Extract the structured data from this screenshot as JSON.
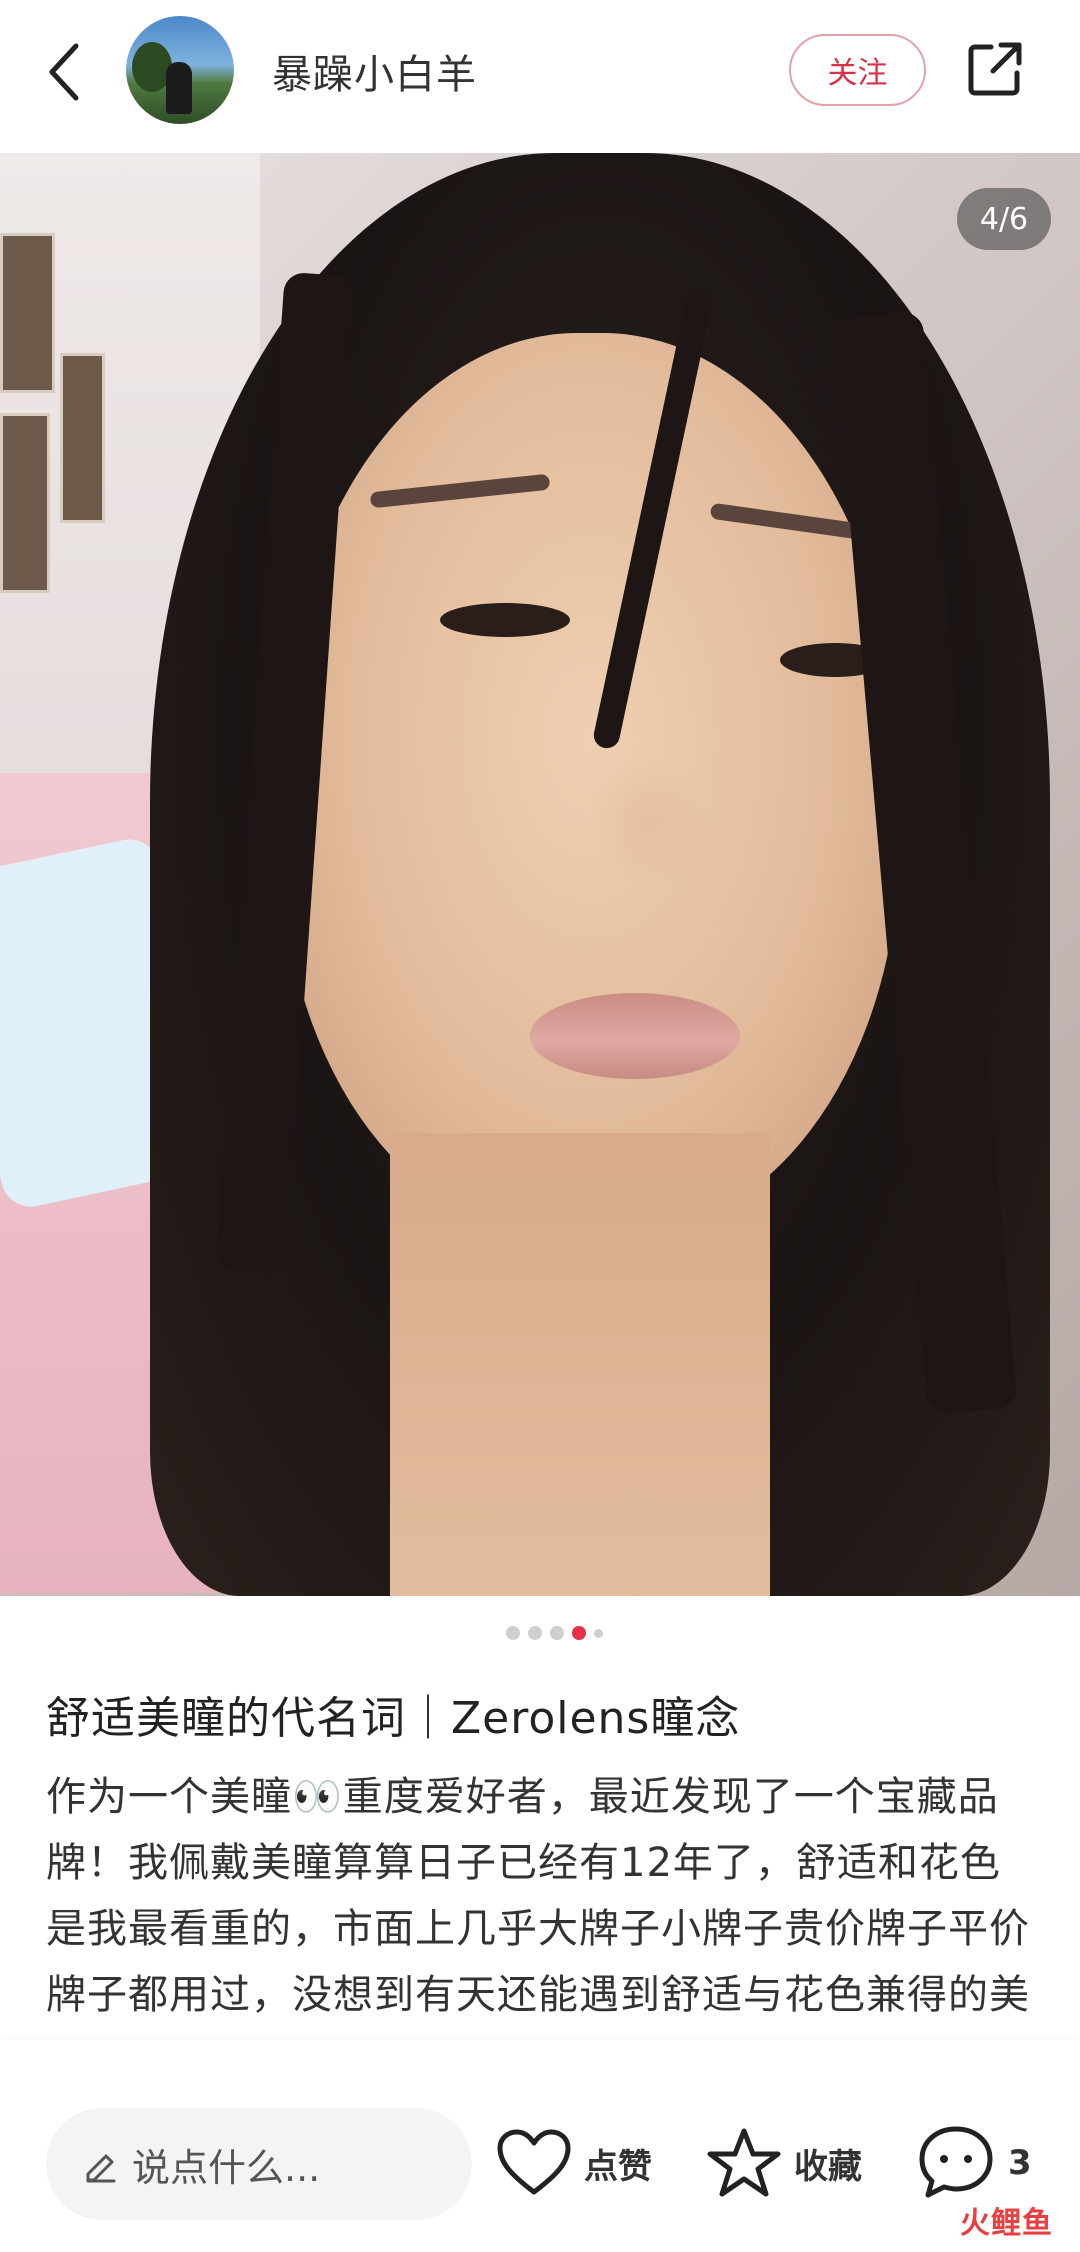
{
  "header": {
    "username": "暴躁小白羊",
    "follow_label": "关注"
  },
  "gallery": {
    "page_indicator": "4/6",
    "current_index": 4,
    "total": 6
  },
  "post": {
    "title": "舒适美瞳的代名词｜Zerolens瞳念",
    "body": "作为一个美瞳👀重度爱好者，最近发现了一个宝藏品牌！我佩戴美瞳算算日子已经有12年了，舒适和花色是我最看重的，市面上几乎大牌子小牌子贵价牌子平价牌子都用过，没想到有天还能遇到舒适与花色兼得的美瞳！"
  },
  "bottom_bar": {
    "comment_placeholder": "说点什么...",
    "like_label": "点赞",
    "collect_label": "收藏",
    "comment_count": "3"
  },
  "watermark": "火鲤鱼",
  "colors": {
    "accent": "#e6304a",
    "follow_border": "#e0a3a9"
  },
  "icons": [
    "back-arrow-icon",
    "share-icon",
    "edit-pencil-icon",
    "heart-icon",
    "star-icon",
    "comment-bubble-icon"
  ]
}
